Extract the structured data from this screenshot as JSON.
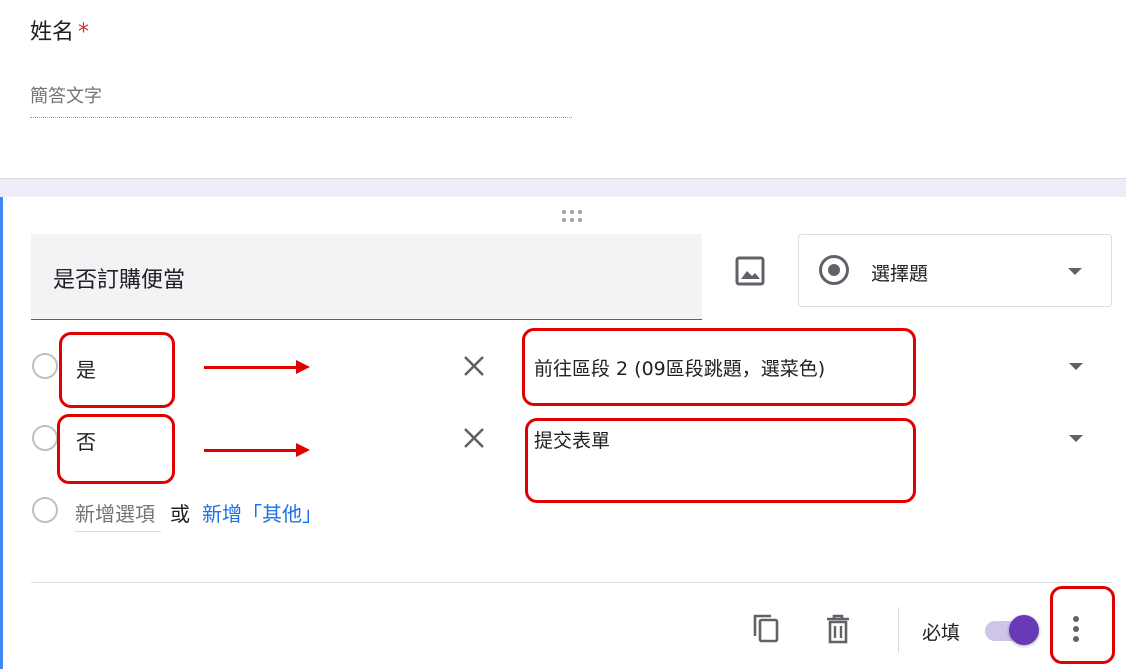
{
  "question1": {
    "title": "姓名",
    "required_mark": "*",
    "placeholder": "簡答文字"
  },
  "question2": {
    "title": "是否訂購便當",
    "type_select": {
      "value": "選擇題",
      "icon": "radio-button-checked-icon"
    },
    "options": [
      {
        "label": "是",
        "destination": "前往區段 2 (09區段跳題，選菜色)"
      },
      {
        "label": "否",
        "destination": "提交表單"
      }
    ],
    "add_option": "新增選項",
    "or_text": "或",
    "add_other": "新增「其他」",
    "footer": {
      "required_label": "必填",
      "required_on": true
    }
  },
  "colors": {
    "accent": "#673ab7",
    "link": "#1a73e8",
    "annotation": "#e00000",
    "active_border": "#4285f4",
    "required_star": "#d93025"
  },
  "icons": [
    "drag-handle-icon",
    "image-icon",
    "radio-button-checked-icon",
    "chevron-down-icon",
    "close-icon",
    "copy-icon",
    "delete-icon",
    "more-vert-icon"
  ]
}
